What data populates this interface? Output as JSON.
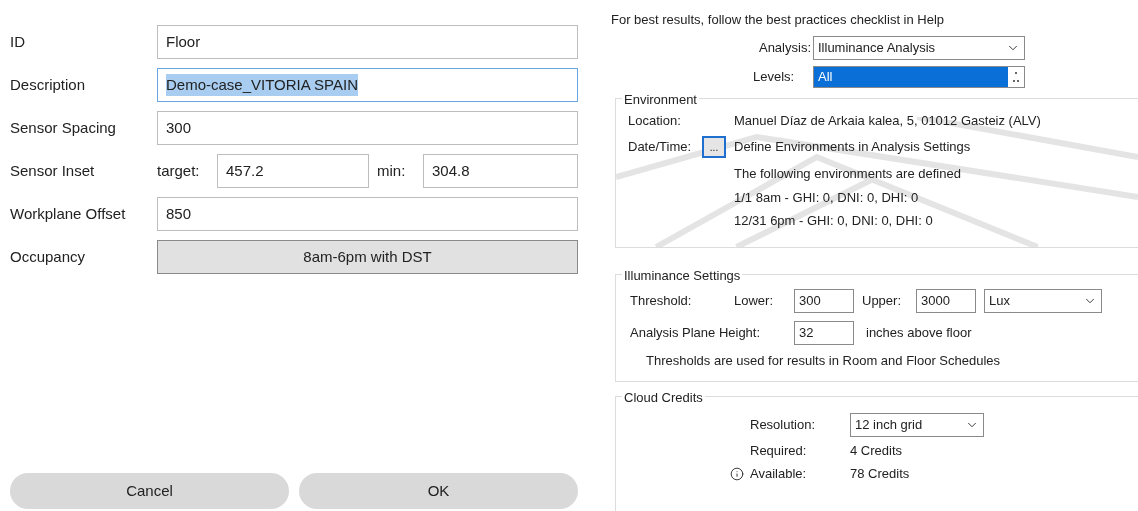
{
  "form": {
    "rows": [
      {
        "kind": "text",
        "label": "ID",
        "value": "Floor",
        "focused": false
      },
      {
        "kind": "text",
        "label": "Description",
        "value": "Demo-case_VITORIA SPAIN",
        "focused": true
      },
      {
        "kind": "text",
        "label": "Sensor Spacing",
        "value": "300",
        "focused": false
      },
      {
        "kind": "pair",
        "label": "Sensor Inset",
        "first_label": "target:",
        "first_value": "457.2",
        "second_label": "min:",
        "second_value": "304.8"
      },
      {
        "kind": "text",
        "label": "Workplane Offset",
        "value": "850",
        "focused": false
      },
      {
        "kind": "button",
        "label": "Occupancy",
        "value": "8am-6pm with DST"
      }
    ],
    "buttons": [
      "Cancel",
      "OK"
    ]
  },
  "settings": {
    "hint": "For best results, follow the best practices checklist in Help",
    "analysis": {
      "label": "Analysis:",
      "value": "Illuminance Analysis"
    },
    "levels": {
      "label": "Levels:",
      "value": "All"
    },
    "environment": {
      "title": "Environment",
      "location_label": "Location:",
      "location": "Manuel Díaz de Arkaia kalea, 5, 01012 Gasteiz (ALV)",
      "datetime_label": "Date/Time:",
      "datetime_button": "...",
      "datetime_text": "Define Environments in Analysis Settings",
      "lines": [
        "The following environments are defined",
        "1/1 8am - GHI: 0, DNI: 0, DHI: 0",
        "12/31 6pm - GHI: 0, DNI: 0, DHI: 0"
      ]
    },
    "illuminance": {
      "title": "Illuminance Settings",
      "threshold_label": "Threshold:",
      "lower_label": "Lower:",
      "lower": "300",
      "upper_label": "Upper:",
      "upper": "3000",
      "unit": "Lux",
      "plane_label": "Analysis Plane Height:",
      "plane": "32",
      "plane_unit": "inches above floor",
      "note": "Thresholds are used for results in Room and Floor Schedules"
    },
    "credits": {
      "title": "Cloud Credits",
      "resolution_label": "Resolution:",
      "resolution": "12 inch grid",
      "required_label": "Required:",
      "required": "4 Credits",
      "available_label": "Available:",
      "available": "78 Credits"
    }
  }
}
